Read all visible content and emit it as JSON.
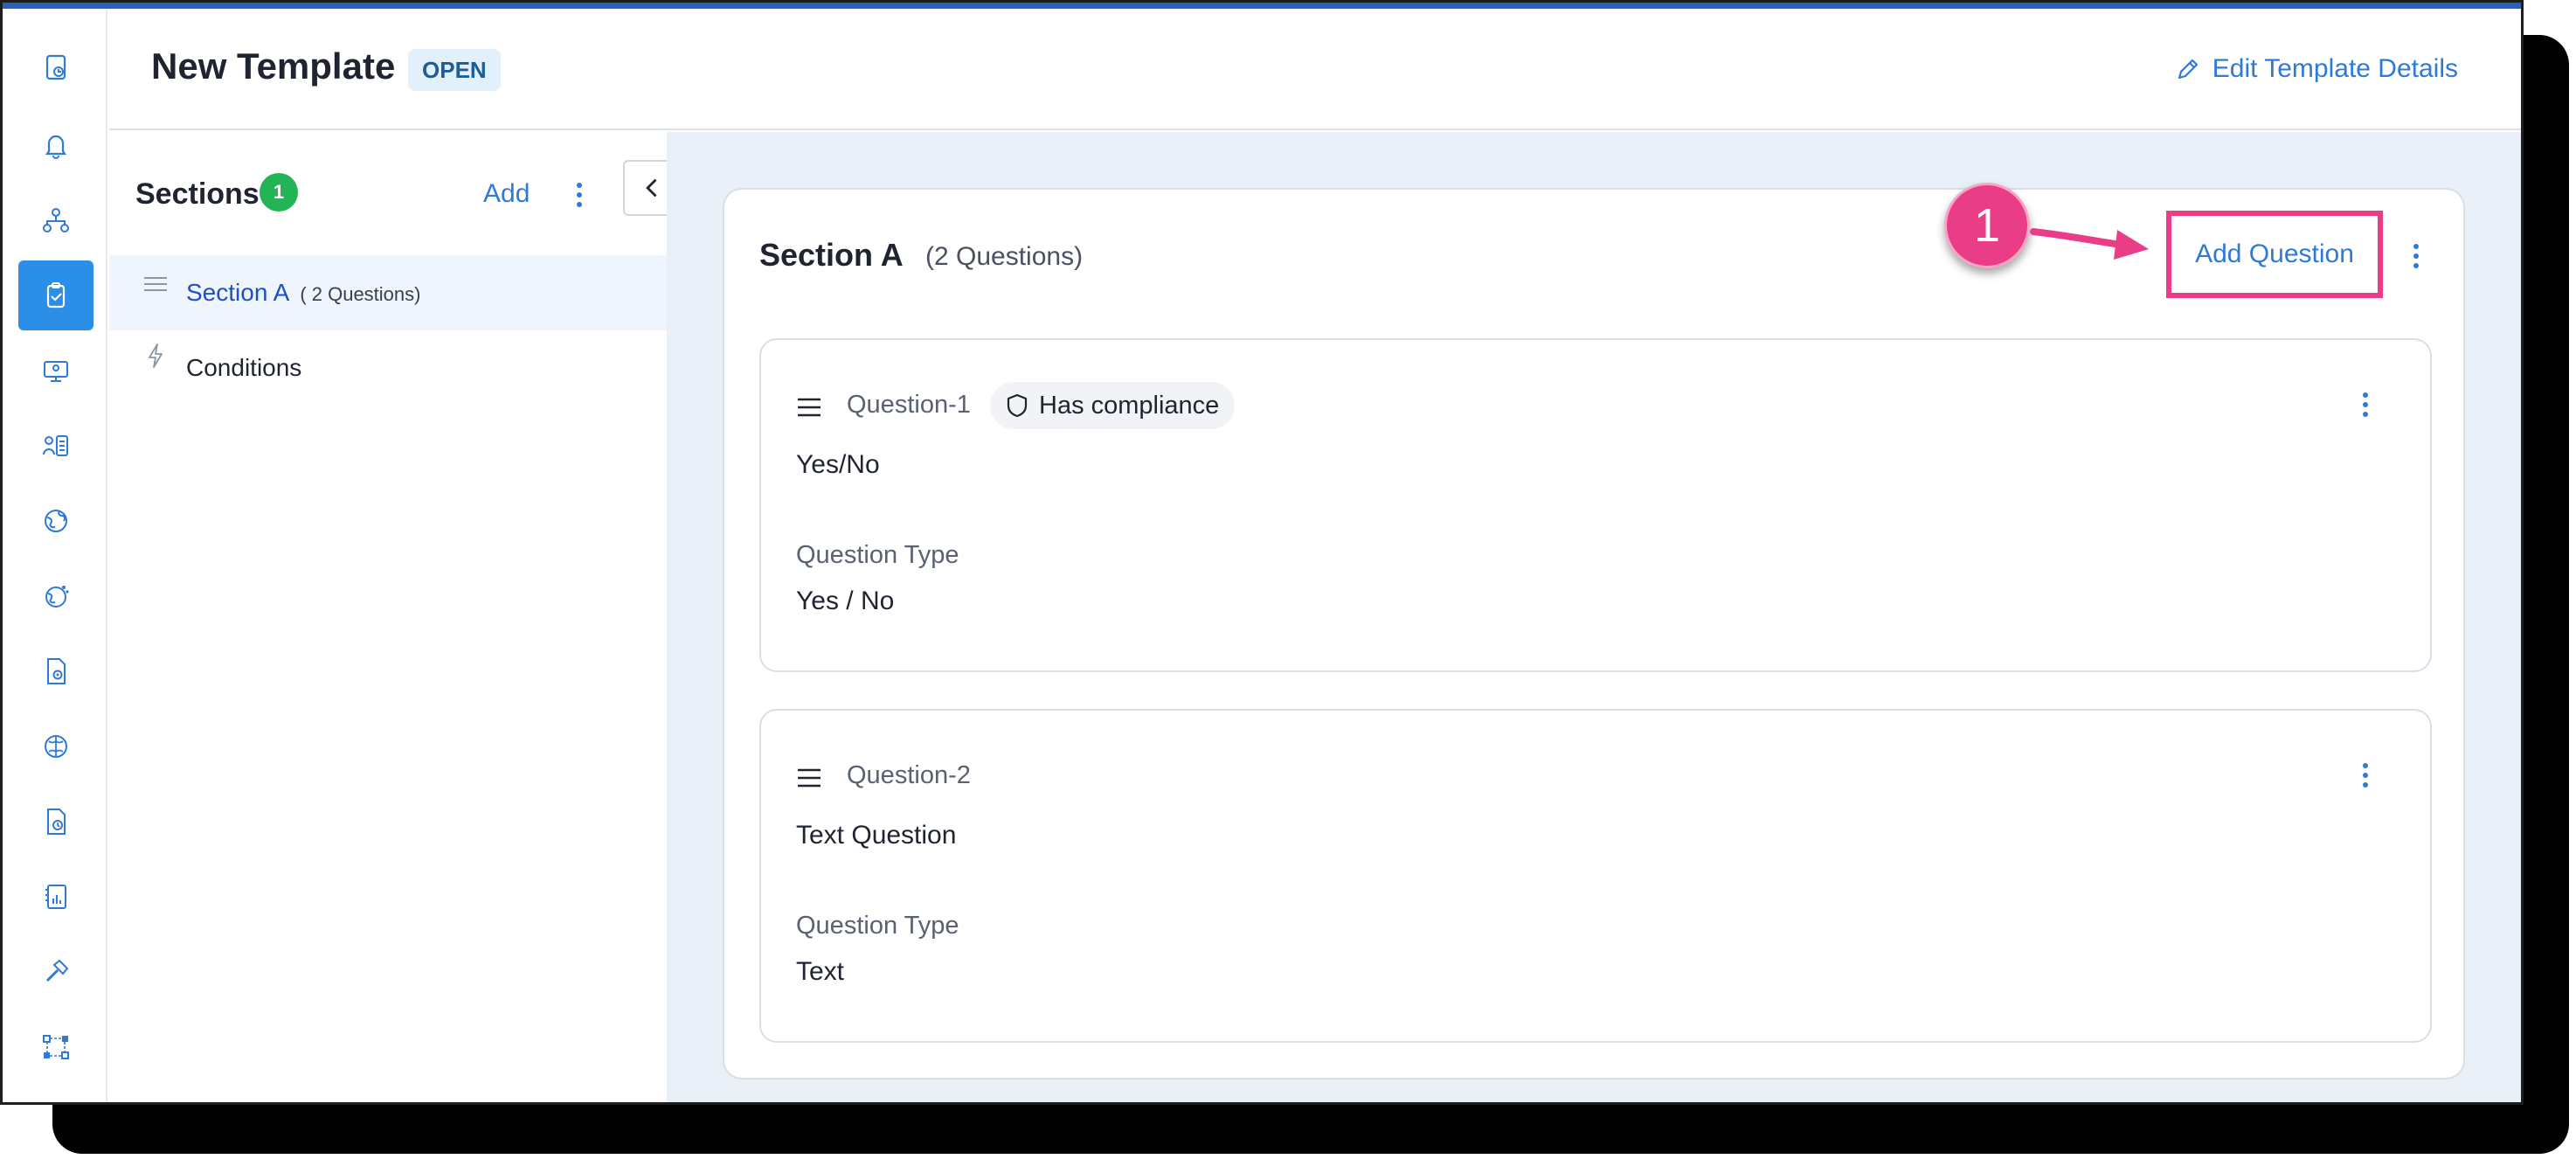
{
  "header": {
    "title": "New Template",
    "status": "OPEN",
    "edit_label": "Edit Template Details"
  },
  "rail": {
    "icons": [
      "dashboard-icon",
      "bell-icon",
      "org-chart-icon",
      "clipboard-check-icon",
      "monitor-user-icon",
      "user-list-icon",
      "globe-icon",
      "globe-dots-icon",
      "document-settings-icon",
      "brain-icon",
      "document-clock-icon",
      "report-chart-icon",
      "hammer-icon",
      "workflow-icon"
    ],
    "active_index": 3
  },
  "sections_panel": {
    "title": "Sections",
    "count": "1",
    "add_label": "Add",
    "items": [
      {
        "label": "Section A",
        "sub": "( 2 Questions)"
      },
      {
        "label": "Conditions",
        "sub": ""
      }
    ]
  },
  "section_card": {
    "title": "Section A",
    "subtitle": "(2 Questions)",
    "add_question_label": "Add Question",
    "questions": [
      {
        "label": "Question-1",
        "badge": "Has compliance",
        "text": "Yes/No",
        "type_label": "Question Type",
        "type_value": "Yes / No"
      },
      {
        "label": "Question-2",
        "badge": "",
        "text": "Text Question",
        "type_label": "Question Type",
        "type_value": "Text"
      }
    ]
  },
  "annotation": {
    "step_number": "1"
  },
  "colors": {
    "accent": "#2e7ad6",
    "active_rail": "#2b8fe8",
    "highlight": "#ea3d88",
    "badge_green": "#22b455"
  }
}
